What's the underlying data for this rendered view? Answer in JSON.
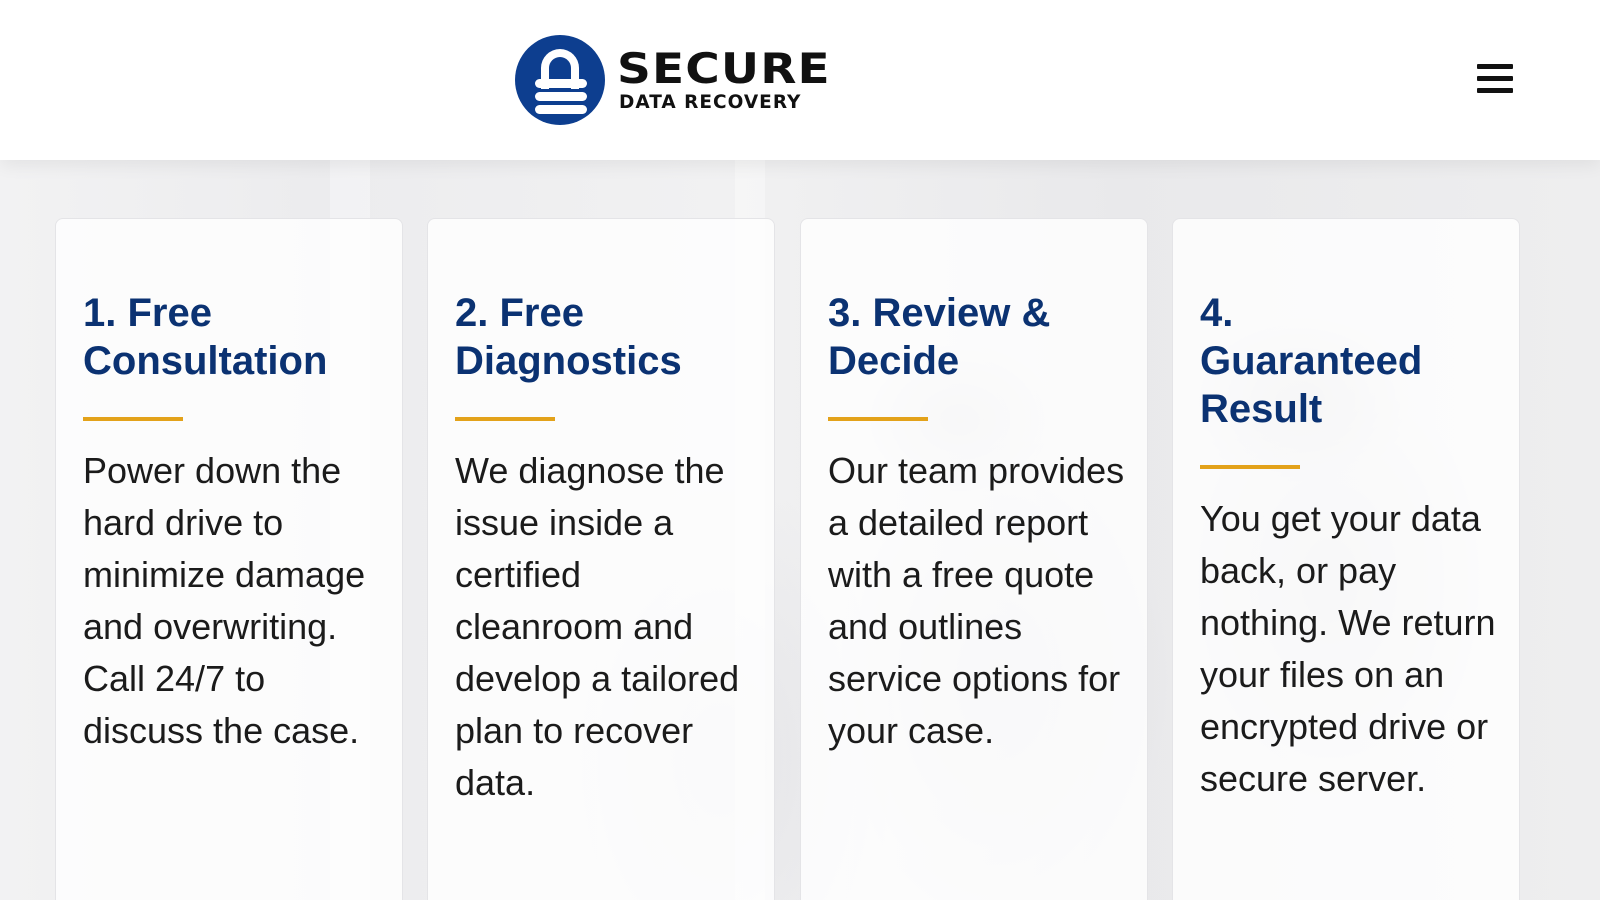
{
  "header": {
    "logo_main": "SECURE",
    "logo_sub": "DATA RECOVERY",
    "logo_icon": "lock-icon",
    "menu_icon": "hamburger-menu-icon"
  },
  "colors": {
    "brand_blue": "#0d3e8f",
    "heading_blue": "#0b3272",
    "accent_gold": "#e3a21a"
  },
  "steps": [
    {
      "title": "1. Free Consultation",
      "text": "Power down the hard drive to minimize damage and overwriting. Call 24/7 to discuss the case."
    },
    {
      "title": "2. Free Diagnostics",
      "text": "We diagnose the issue inside a certified cleanroom and develop a tailored plan to recover data."
    },
    {
      "title": "3. Review & Decide",
      "text": "Our team provides a detailed report with a free quote and outlines service options for your case."
    },
    {
      "title": "4. Guaranteed Result",
      "text": "You get your data back, or pay nothing. We return your files on an encrypted drive or secure server."
    }
  ]
}
